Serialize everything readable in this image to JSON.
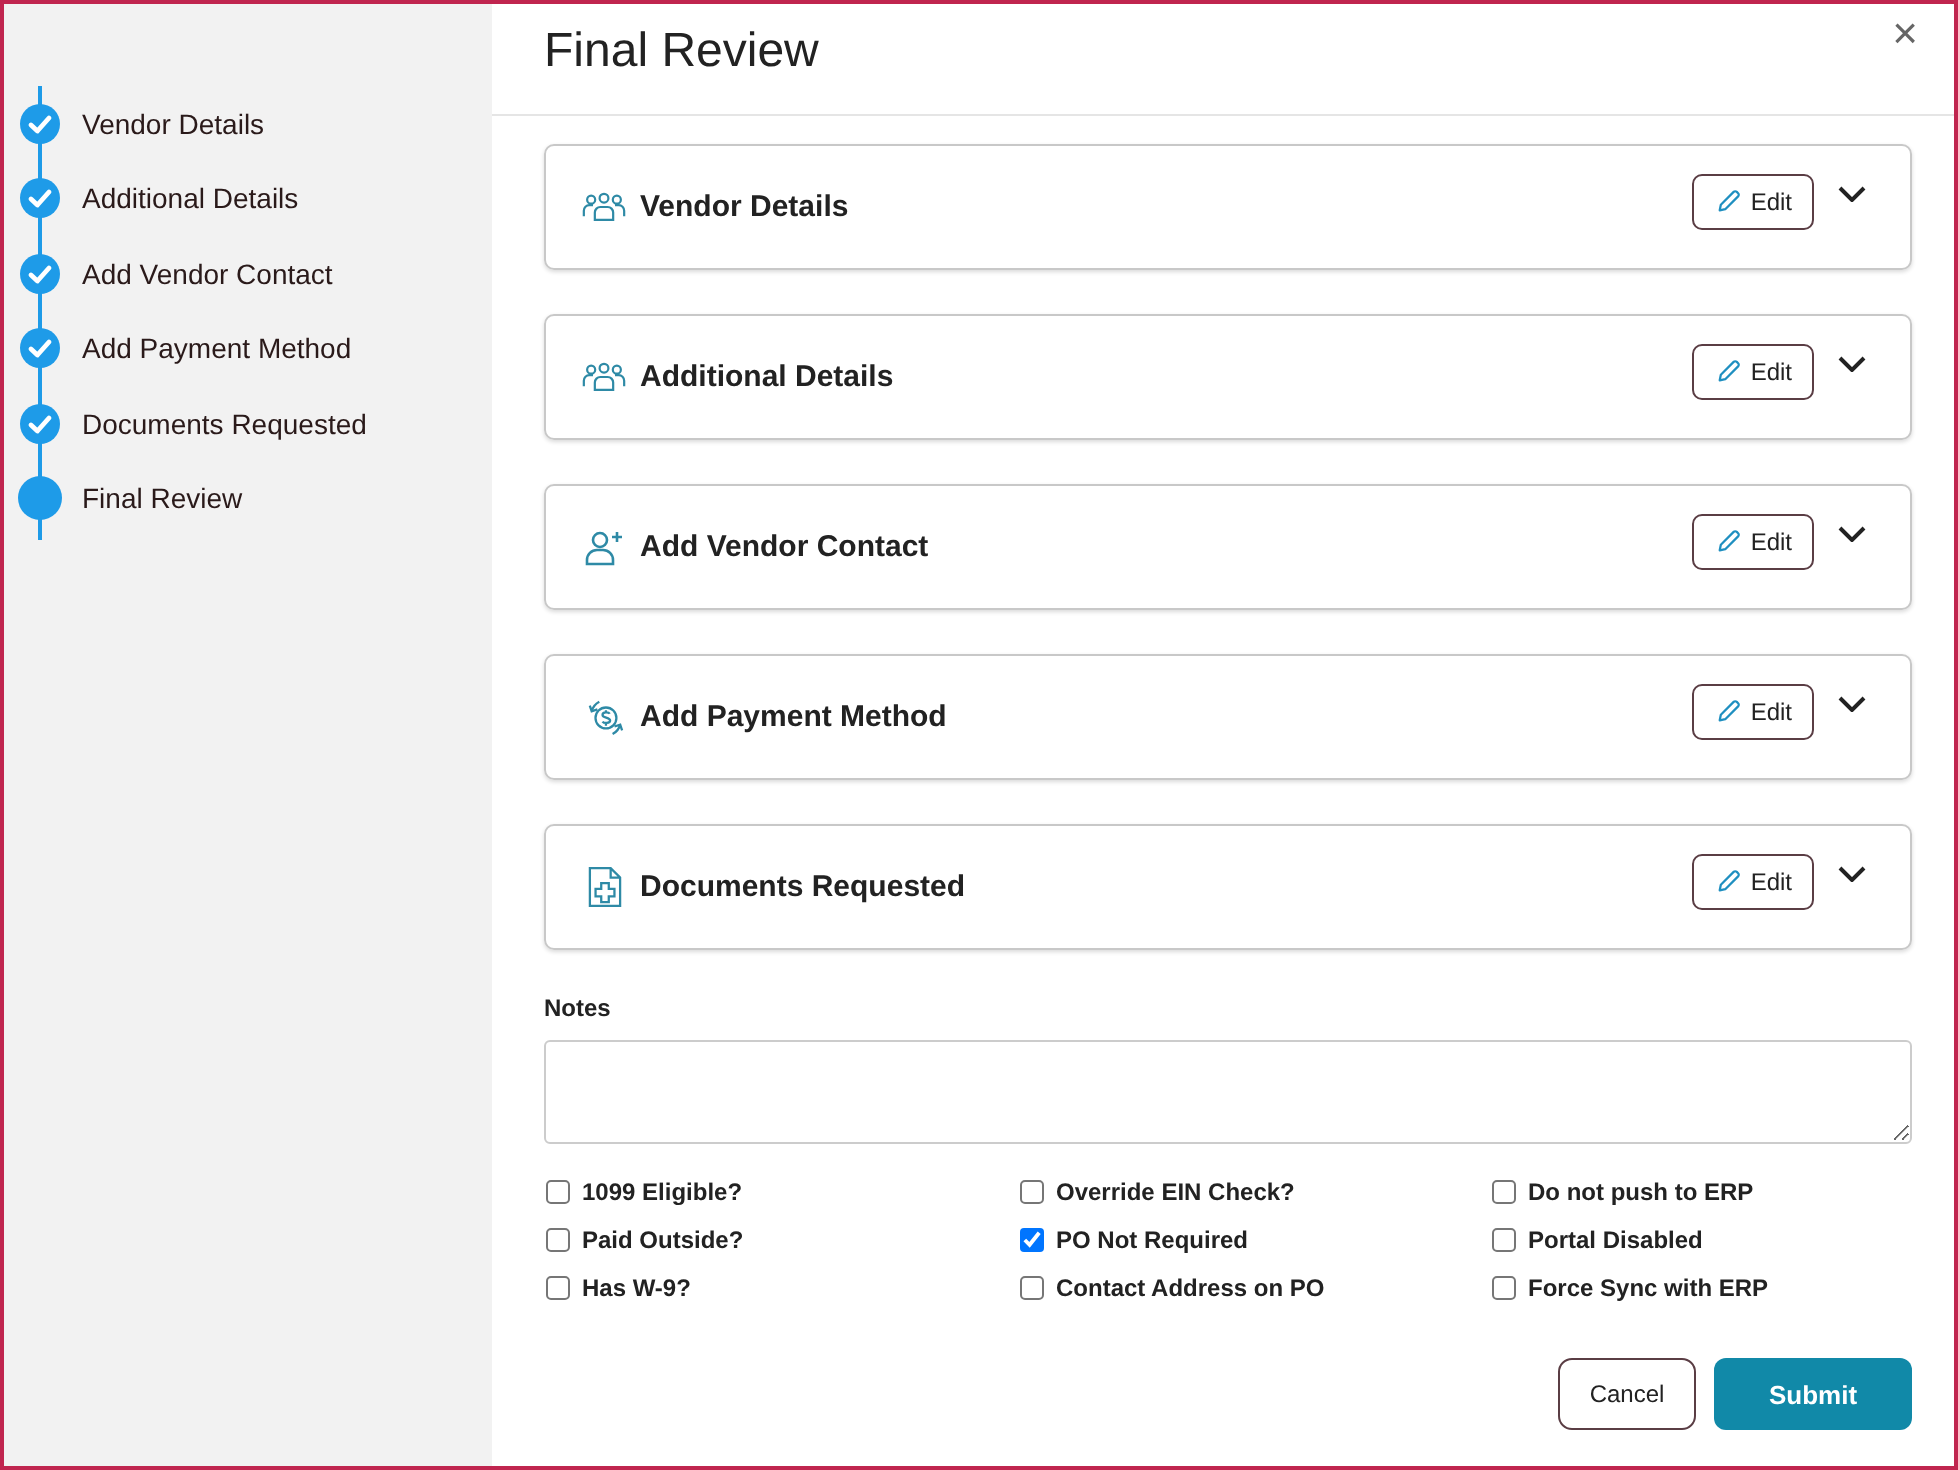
{
  "steps": [
    {
      "label": "Vendor Details",
      "completed": true
    },
    {
      "label": "Additional Details",
      "completed": true
    },
    {
      "label": "Add Vendor Contact",
      "completed": true
    },
    {
      "label": "Add Payment Method",
      "completed": true
    },
    {
      "label": "Documents Requested",
      "completed": true
    },
    {
      "label": "Final Review",
      "completed": false
    }
  ],
  "title": "Final Review",
  "close": "×",
  "sections": [
    {
      "kind": "group",
      "title": "Vendor Details",
      "edit": "Edit",
      "expanded": false
    },
    {
      "kind": "group",
      "title": "Additional Details",
      "edit": "Edit",
      "expanded": false
    },
    {
      "kind": "contact",
      "title": "Add Vendor Contact",
      "edit": "Edit",
      "expanded": false
    },
    {
      "kind": "payment",
      "title": "Add Payment Method",
      "edit": "Edit",
      "expanded": false
    },
    {
      "kind": "document",
      "title": "Documents Requested",
      "edit": "Edit",
      "expanded": false
    }
  ],
  "notes": {
    "label": "Notes"
  },
  "options": [
    {
      "label": "1099 Eligible?",
      "checked": false
    },
    {
      "label": "Override EIN Check?",
      "checked": false
    },
    {
      "label": "Do not push to ERP",
      "checked": false
    },
    {
      "label": "Paid Outside?",
      "checked": false
    },
    {
      "label": "PO Not Required",
      "checked": true
    },
    {
      "label": "Portal Disabled",
      "checked": false
    },
    {
      "label": "Has W-9?",
      "checked": false
    },
    {
      "label": "Contact Address on PO",
      "checked": false
    },
    {
      "label": "Force Sync with ERP",
      "checked": false
    }
  ],
  "buttons": {
    "cancel": "Cancel",
    "submit": "Submit"
  }
}
